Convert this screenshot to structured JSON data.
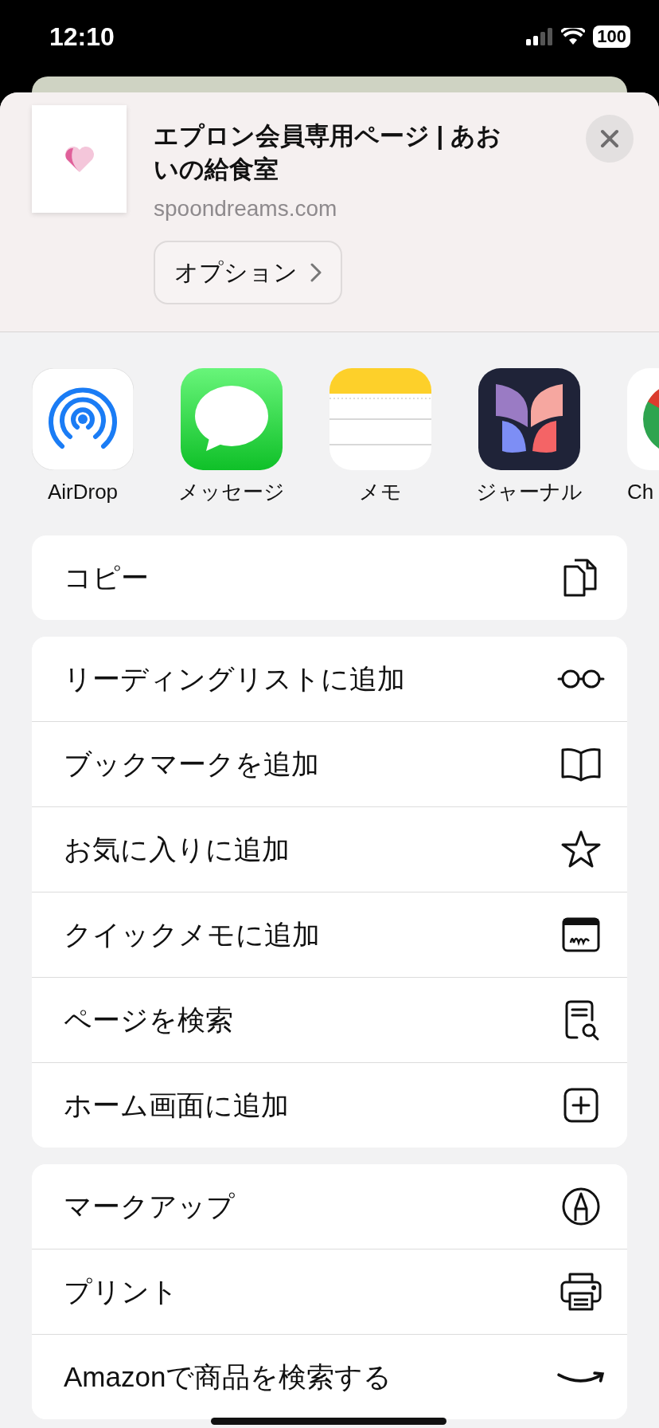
{
  "status_bar": {
    "time": "12:10",
    "battery": "100"
  },
  "share_header": {
    "title": "エプロン会員専用ページ | あおいの給食室",
    "domain": "spoondreams.com",
    "options_button": "オプション"
  },
  "apps": [
    {
      "label": "AirDrop",
      "kind": "airdrop"
    },
    {
      "label": "メッセージ",
      "kind": "messages"
    },
    {
      "label": "メモ",
      "kind": "notes"
    },
    {
      "label": "ジャーナル",
      "kind": "journal"
    },
    {
      "label": "Ch",
      "kind": "browser"
    }
  ],
  "action_groups": [
    {
      "actions": [
        {
          "label": "コピー",
          "kind": "copy"
        }
      ]
    },
    {
      "actions": [
        {
          "label": "リーディングリストに追加",
          "kind": "glasses"
        },
        {
          "label": "ブックマークを追加",
          "kind": "book"
        },
        {
          "label": "お気に入りに追加",
          "kind": "star"
        },
        {
          "label": "クイックメモに追加",
          "kind": "quicknote"
        },
        {
          "label": "ページを検索",
          "kind": "findpage"
        },
        {
          "label": "ホーム画面に追加",
          "kind": "addhome"
        }
      ]
    },
    {
      "actions": [
        {
          "label": "マークアップ",
          "kind": "markup"
        },
        {
          "label": "プリント",
          "kind": "print"
        },
        {
          "label": "Amazonで商品を検索する",
          "kind": "amazon"
        }
      ]
    }
  ]
}
